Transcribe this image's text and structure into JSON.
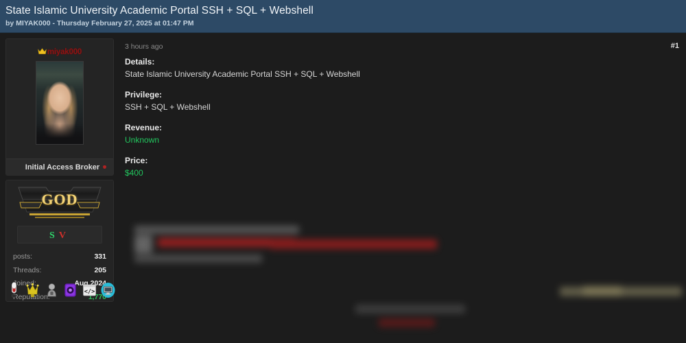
{
  "thread": {
    "title": "State Islamic University Academic Portal SSH + SQL + Webshell",
    "byline": "by MIYAK000 - Thursday February 27, 2025 at 01:47 PM"
  },
  "post": {
    "timestamp": "3 hours ago",
    "number": "#1",
    "fields": [
      {
        "label": "Details:",
        "value": "State Islamic University Academic Portal SSH + SQL + Webshell",
        "color": "default"
      },
      {
        "label": "Privilege:",
        "value": "SSH + SQL + Webshell",
        "color": "default"
      },
      {
        "label": "Revenue:",
        "value": "Unknown",
        "color": "green"
      },
      {
        "label": "Price:",
        "value": "$400",
        "color": "green"
      }
    ]
  },
  "author": {
    "username": "miyak000",
    "crown_icon": "crown-icon",
    "avatar_alt": "user-avatar-photo",
    "user_title": "Initial Access Broker",
    "status": "offline",
    "rank_banner_text": "GOD",
    "badges": [
      {
        "name": "badge-seller",
        "glyph": "S",
        "color": "#2fd36b"
      },
      {
        "name": "badge-verified",
        "glyph": "V",
        "color": "#d0302a"
      }
    ],
    "stats": [
      {
        "label": "posts:",
        "value": "331",
        "accent": false
      },
      {
        "label": "Threads:",
        "value": "205",
        "accent": false
      },
      {
        "label": "Joined:",
        "value": "Aug 2024",
        "accent": false
      },
      {
        "label": "Reputation:",
        "value": "1,770",
        "accent": true
      }
    ],
    "awards": [
      "award-syringe-icon",
      "award-crown-trophy-icon",
      "award-lock-figure-icon",
      "award-purple-ring-icon",
      "award-code-window-icon",
      "award-monitor-icon"
    ]
  },
  "redacted": {
    "block_1": "redacted-content-block",
    "block_2": "redacted-content-block",
    "block_3": "redacted-content-block"
  },
  "colors": {
    "header_bg": "#2d4a66",
    "page_bg": "#1c1c1c",
    "card_bg": "#242424",
    "accent_green": "#22c55e",
    "username_red": "#8c1414",
    "rank_gold": "#f2d377"
  }
}
